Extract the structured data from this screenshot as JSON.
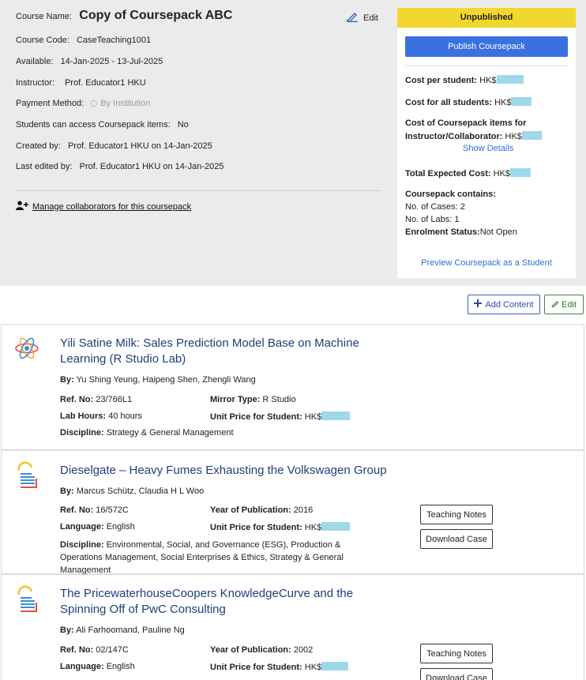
{
  "course": {
    "name_label": "Course Name:",
    "name": "Copy of Coursepack ABC",
    "edit_label": "Edit",
    "code_label": "Course Code:",
    "code": "CaseTeaching1001",
    "available_label": "Available:",
    "available": "14-Jan-2025 - 13-Jul-2025",
    "instructor_label": "Instructor:",
    "instructor": "Prof. Educator1 HKU",
    "payment_label": "Payment Method:",
    "payment": "By Institution",
    "access_label": "Students can access Coursepack items:",
    "access": "No",
    "created_label": "Created by:",
    "created": "Prof. Educator1 HKU on 14-Jan-2025",
    "edited_label": "Last edited by:",
    "edited": "Prof. Educator1 HKU on 14-Jan-2025",
    "manage_link": "Manage collaborators for this coursepack"
  },
  "panel": {
    "status": "Unpublished",
    "publish_button": "Publish Coursepack",
    "cost_per_student": "Cost per student:",
    "cost_all_students": "Cost for all students:",
    "cost_items_line1": "Cost of Coursepack items for",
    "cost_items_line2": "Instructor/Collaborator:",
    "currency": "HK$",
    "show_details": "Show Details",
    "total_expected": "Total Expected Cost:",
    "contains_label": "Coursepack contains:",
    "cases_label": "No. of Cases:",
    "cases": "2",
    "labs_label": "No. of Labs:",
    "labs": "1",
    "enrol_label": "Enrolment Status:",
    "enrol": "Not Open",
    "preview_link": "Preview Coursepack as a Student"
  },
  "toolbar": {
    "add_content": "Add Content",
    "edit": "Edit"
  },
  "items": [
    {
      "title": "Yili Satine Milk: Sales Prediction Model Base on Machine Learning (R Studio Lab)",
      "by_label": "By:",
      "by": "Yu Shing Yeung, Haipeng Shen, Zhengli Wang",
      "ref_label": "Ref. No:",
      "ref": "23/766L1",
      "mirror_label": "Mirror Type:",
      "mirror": "R Studio",
      "hours_label": "Lab Hours:",
      "hours": "40 hours",
      "price_label": "Unit Price for Student:",
      "price": "HK$",
      "discipline_label": "Discipline:",
      "discipline": "Strategy & General Management"
    },
    {
      "title": "Dieselgate – Heavy Fumes Exhausting the Volkswagen Group",
      "by_label": "By:",
      "by": "Marcus Schütz, Claudia H L Woo",
      "ref_label": "Ref. No:",
      "ref": "16/572C",
      "year_label": "Year of Publication:",
      "year": "2016",
      "lang_label": "Language:",
      "lang": "English",
      "price_label": "Unit Price for Student:",
      "price": "HK$",
      "discipline_label": "Discipline:",
      "discipline": "Environmental, Social, and Governance (ESG), Production & Operations Management, Social Enterprises & Ethics, Strategy & General Management",
      "notes_button": "Teaching Notes",
      "download_button": "Download Case"
    },
    {
      "title": "The PricewaterhouseCoopers KnowledgeCurve and the Spinning Off of PwC Consulting",
      "by_label": "By:",
      "by": "Ali Farhoomand, Pauline Ng",
      "ref_label": "Ref. No:",
      "ref": "02/147C",
      "year_label": "Year of Publication:",
      "year": "2002",
      "lang_label": "Language:",
      "lang": "English",
      "price_label": "Unit Price for Student:",
      "price": "HK$",
      "notes_button": "Teaching Notes",
      "download_button": "Download Case"
    }
  ],
  "colors": {
    "status_yellow": "#f2d82e",
    "primary_blue": "#3a70e0",
    "link_blue": "#2a6fd6",
    "title_navy": "#1f3f7a",
    "edit_green": "#2e7a2e",
    "price_mask": "#9fd8ea"
  },
  "icons": [
    "edit-pencil-icon",
    "user-plus-icon",
    "plus-icon",
    "atom-icon",
    "case-document-icon"
  ]
}
